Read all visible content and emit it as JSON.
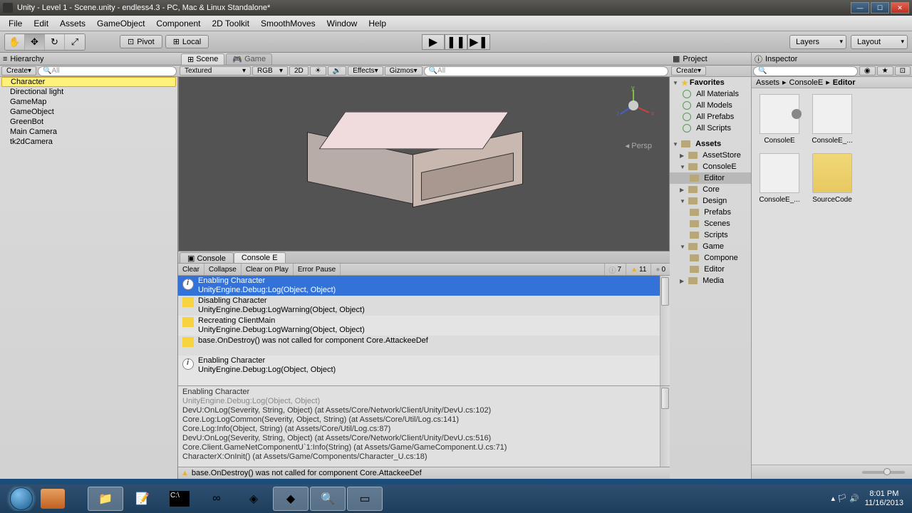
{
  "window": {
    "title": "Unity - Level 1 - Scene.unity - endless4.3 - PC, Mac & Linux Standalone*"
  },
  "menu": [
    "File",
    "Edit",
    "Assets",
    "GameObject",
    "Component",
    "2D Toolkit",
    "SmoothMoves",
    "Window",
    "Help"
  ],
  "toolbar": {
    "pivot": "Pivot",
    "local": "Local",
    "layers": "Layers",
    "layout": "Layout"
  },
  "hierarchy": {
    "title": "Hierarchy",
    "create": "Create",
    "search": "All",
    "items": [
      "Character",
      "Directional light",
      "GameMap",
      "GameObject",
      "GreenBot",
      "Main Camera",
      "tk2dCamera"
    ]
  },
  "scene": {
    "tabScene": "Scene",
    "tabGame": "Game",
    "textured": "Textured",
    "rgb": "RGB",
    "mode2d": "2D",
    "effects": "Effects",
    "gizmos": "Gizmos",
    "search": "All",
    "persp": "Persp"
  },
  "console": {
    "tabConsole": "Console",
    "tabConsoleE": "Console E",
    "clear": "Clear",
    "collapse": "Collapse",
    "clearOnPlay": "Clear on Play",
    "errorPause": "Error Pause",
    "countInfo": "7",
    "countWarn": "11",
    "countErr": "0",
    "logs": [
      {
        "type": "info",
        "line1": "Enabling Character",
        "line2": "UnityEngine.Debug:Log(Object, Object)"
      },
      {
        "type": "warn",
        "line1": "Disabling Character",
        "line2": "UnityEngine.Debug:LogWarning(Object, Object)"
      },
      {
        "type": "warn",
        "line1": "Recreating ClientMain",
        "line2": "UnityEngine.Debug:LogWarning(Object, Object)"
      },
      {
        "type": "warn",
        "line1": "base.OnDestroy() was not called for component Core.AttackeeDef",
        "line2": ""
      },
      {
        "type": "info",
        "line1": "Enabling Character",
        "line2": "UnityEngine.Debug:Log(Object, Object)"
      }
    ],
    "detail": [
      "Enabling Character",
      "UnityEngine.Debug:Log(Object, Object)",
      "DevU:OnLog(Severity, String, Object) (at Assets/Core/Network/Client/Unity/DevU.cs:102)",
      "Core.Log:LogCommon(Severity, Object, String) (at Assets/Core/Util/Log.cs:141)",
      "Core.Log:Info(Object, String) (at Assets/Core/Util/Log.cs:87)",
      "DevU:OnLog(Severity, String, Object) (at Assets/Core/Network/Client/Unity/DevU.cs:516)",
      "Core.Client.GameNetComponentU`1:Info(String) (at Assets/Game/GameComponent.U.cs:71)",
      "CharacterX:OnInit() (at Assets/Game/Components/Character_U.cs:18)"
    ],
    "footer": "base.OnDestroy() was not called for component Core.AttackeeDef"
  },
  "project": {
    "title": "Project",
    "create": "Create",
    "favorites": "Favorites",
    "favItems": [
      "All Materials",
      "All Models",
      "All Prefabs",
      "All Scripts"
    ],
    "assets": "Assets",
    "tree": [
      {
        "name": "AssetStore",
        "depth": 1
      },
      {
        "name": "ConsoleE",
        "depth": 1,
        "open": true
      },
      {
        "name": "Editor",
        "depth": 2,
        "sel": true
      },
      {
        "name": "Core",
        "depth": 1
      },
      {
        "name": "Design",
        "depth": 1,
        "open": true
      },
      {
        "name": "Prefabs",
        "depth": 2
      },
      {
        "name": "Scenes",
        "depth": 2
      },
      {
        "name": "Scripts",
        "depth": 2
      },
      {
        "name": "Game",
        "depth": 1,
        "open": true
      },
      {
        "name": "Compone",
        "depth": 2
      },
      {
        "name": "Editor",
        "depth": 2
      },
      {
        "name": "Media",
        "depth": 1
      }
    ]
  },
  "inspector": {
    "title": "Inspector",
    "breadcrumb": [
      "Assets",
      "ConsoleE",
      "Editor"
    ],
    "items": [
      "ConsoleE",
      "ConsoleE_...",
      "ConsoleE_...",
      "SourceCode"
    ]
  },
  "taskbar": {
    "time": "8:01 PM",
    "date": "11/16/2013"
  }
}
